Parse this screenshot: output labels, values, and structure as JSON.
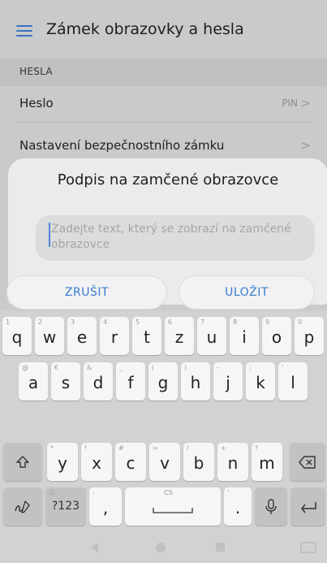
{
  "app_bar": {
    "title": "Zámek obrazovky a hesla"
  },
  "section": {
    "title": "HESLA"
  },
  "rows": [
    {
      "label": "Heslo",
      "value": "PIN"
    },
    {
      "label": "Nastavení bezpečnostního zámku",
      "value": ""
    }
  ],
  "dialog": {
    "title": "Podpis na zamčené obrazovce",
    "input_placeholder": "Zadejte text, který se zobrazí na zamčené obrazovce",
    "cancel_label": "ZRUŠIT",
    "save_label": "ULOŽIT"
  },
  "keyboard": {
    "row1": [
      {
        "char": "q",
        "hint": "1"
      },
      {
        "char": "w",
        "hint": "2"
      },
      {
        "char": "e",
        "hint": "3"
      },
      {
        "char": "r",
        "hint": "4"
      },
      {
        "char": "t",
        "hint": "5"
      },
      {
        "char": "z",
        "hint": "6"
      },
      {
        "char": "u",
        "hint": "7"
      },
      {
        "char": "i",
        "hint": "8"
      },
      {
        "char": "o",
        "hint": "9"
      },
      {
        "char": "p",
        "hint": "0"
      }
    ],
    "row2": [
      {
        "char": "a",
        "hint": "@"
      },
      {
        "char": "s",
        "hint": "€"
      },
      {
        "char": "d",
        "hint": "&"
      },
      {
        "char": "f",
        "hint": "_"
      },
      {
        "char": "g",
        "hint": "("
      },
      {
        "char": "h",
        "hint": ")"
      },
      {
        "char": "j",
        "hint": "-"
      },
      {
        "char": "k",
        "hint": ";"
      },
      {
        "char": "l",
        "hint": "'"
      }
    ],
    "row3": [
      {
        "char": "y",
        "hint": "*"
      },
      {
        "char": "x",
        "hint": "!"
      },
      {
        "char": "c",
        "hint": "#"
      },
      {
        "char": "v",
        "hint": "="
      },
      {
        "char": "b",
        "hint": "/"
      },
      {
        "char": "n",
        "hint": "+"
      },
      {
        "char": "m",
        "hint": "?"
      }
    ],
    "symbols_label": "?123",
    "comma_label": ",",
    "period_label": ".",
    "space_hint": "CS",
    "icons": {
      "shift": "shift-icon",
      "backspace": "backspace-icon",
      "handwriting": "handwriting-icon",
      "mic": "microphone-icon",
      "enter": "enter-icon"
    }
  },
  "colors": {
    "accent": "#3a7bd0",
    "menu_icon": "#3c72c0"
  }
}
